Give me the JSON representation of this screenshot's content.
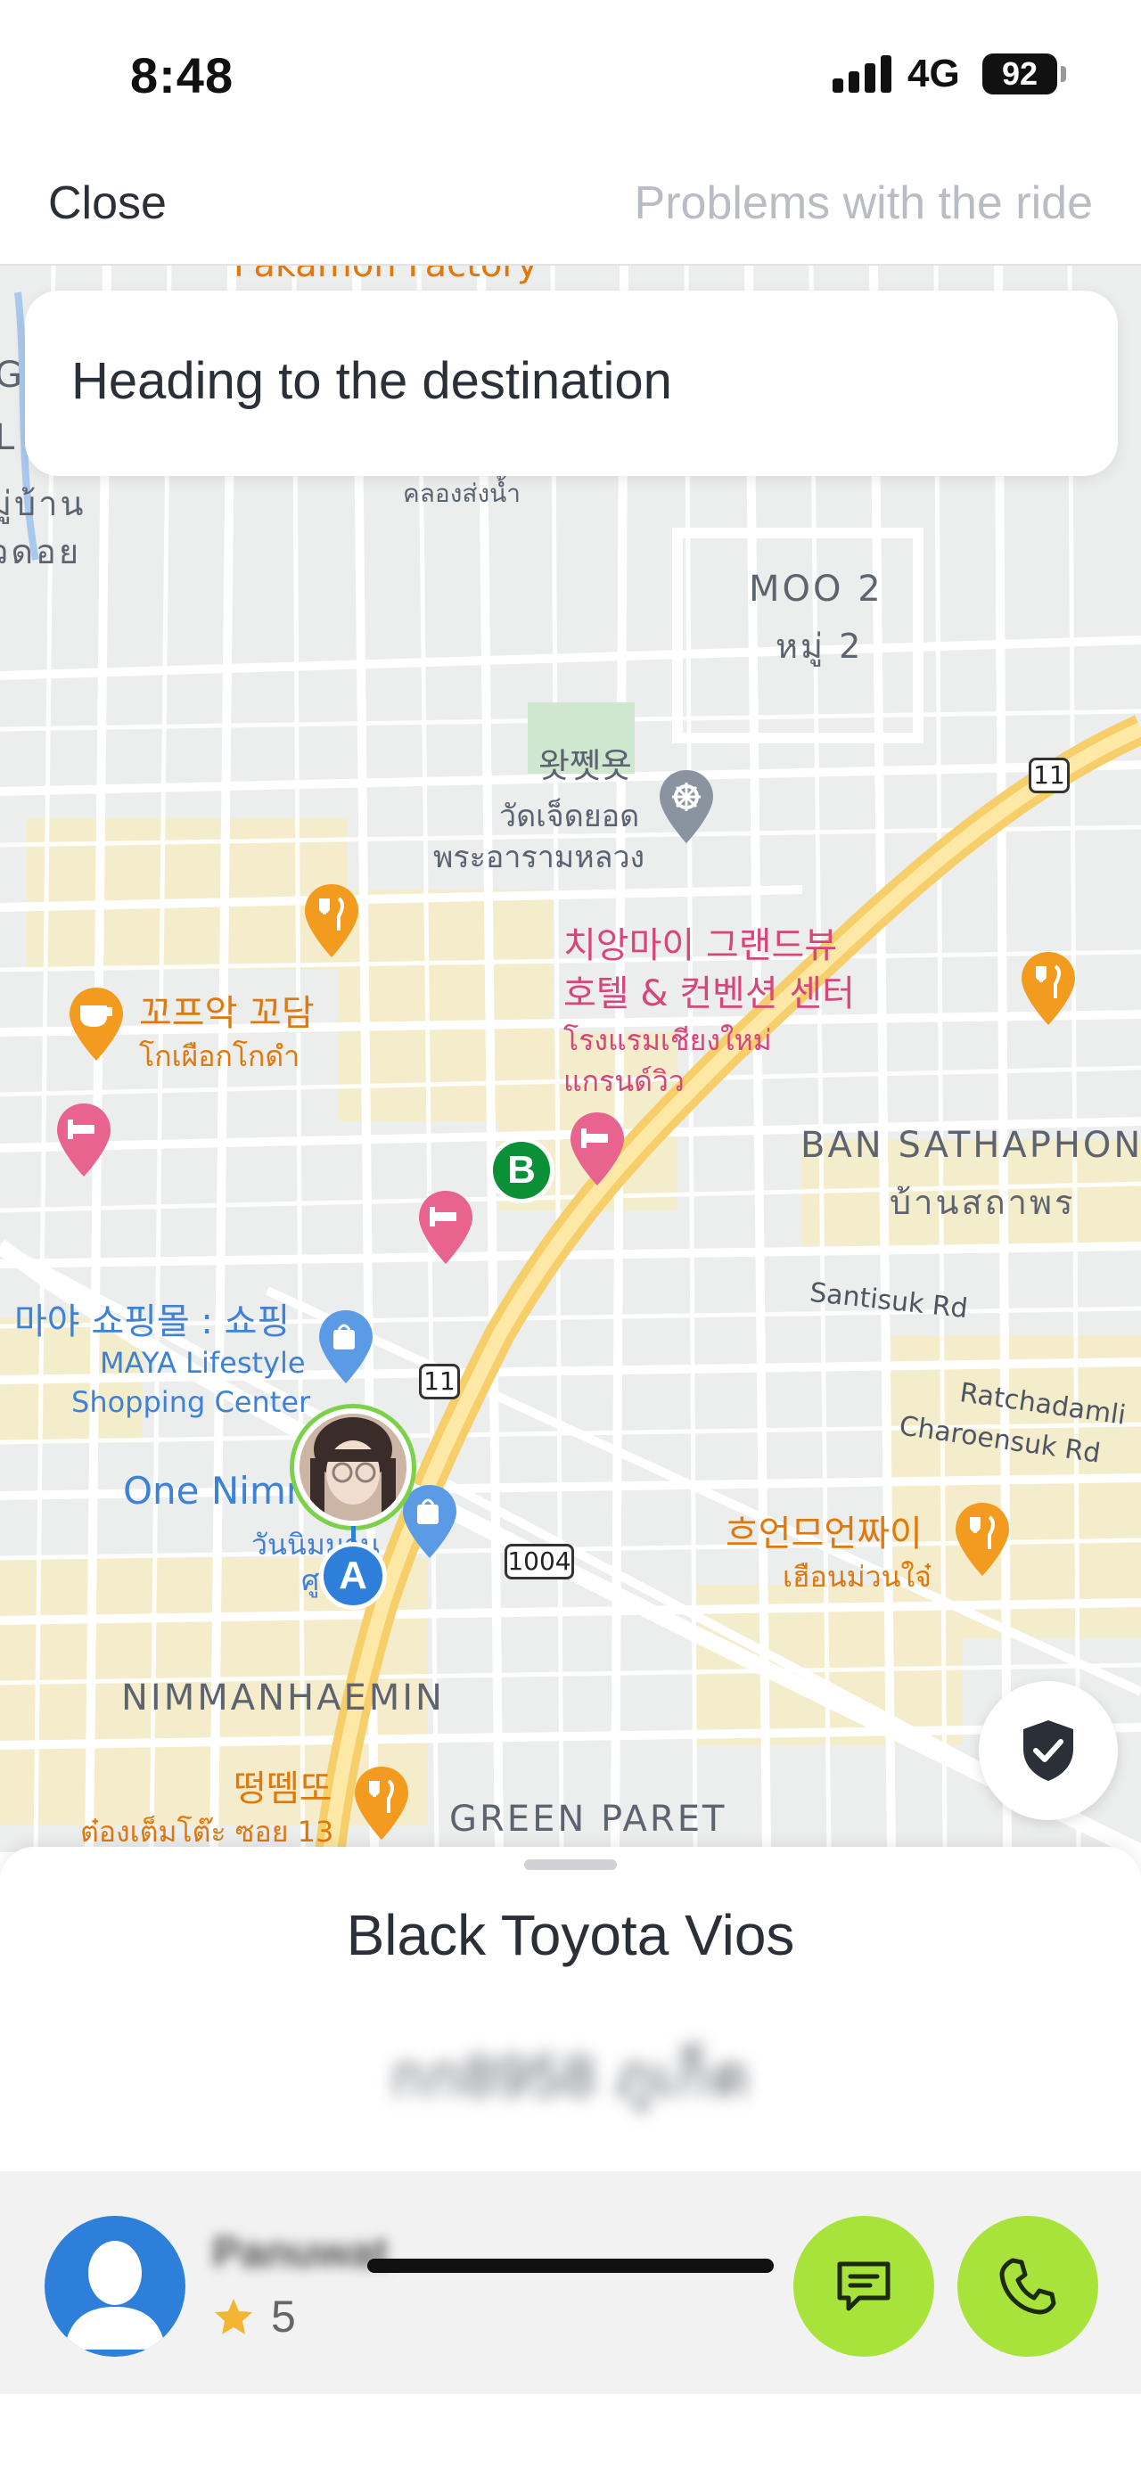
{
  "status_bar": {
    "time": "8:48",
    "network": "4G",
    "battery": "92"
  },
  "nav": {
    "close_label": "Close",
    "problems_label": "Problems with the ride"
  },
  "trip_status": {
    "text": "Heading to the destination"
  },
  "map": {
    "labels": {
      "pakamon": "Pakamon Factory",
      "klong": "คลองส่งน้ำ",
      "moo2": "MOO 2",
      "moo2_th": "หมู่ 2",
      "wat_ko": "왓쩻욧",
      "wat_th1": "วัดเจ็ดยอด",
      "wat_th2": "พระอารามหลวง",
      "hotel_ko1": "치앙마이 그랜드뷰",
      "hotel_ko2": "호텔 & 컨벤션 센터",
      "hotel_th1": "โรงแรมเชียงใหม่",
      "hotel_th2": "แกรนด์วิว",
      "cafe_ko": "꼬프악 꼬담",
      "cafe_th": "โกเผือกโกดำ",
      "ban_sathaphon": "BAN SATHAPHON",
      "ban_sathaphon_th": "บ้านสถาพร",
      "santisuk": "Santisuk Rd",
      "ratchadamli": "Ratchadamli",
      "charoensuk": "Charoensuk Rd",
      "maya_ko": "마야 쇼핑몰 : 쇼핑",
      "maya_en1": "MAYA Lifestyle",
      "maya_en2": "Shopping Center",
      "one_nimman": "One Nimman",
      "one_nimman_th": "วันนิมมาน",
      "one_nimman_th2": "ศูนย์",
      "road_11a": "11",
      "road_11b": "11",
      "road_1004": "1004",
      "restaurant_ko": "흐언므언짜이",
      "restaurant_th": "เฮือนม่วนใจ๋",
      "nimmanhaemin": "NIMMANHAEMIN",
      "green_paret": "GREEN PARET",
      "ddeok_ko": "떵뗌또",
      "ddeok_th": "ต๋องเต็มโต๊ะ ซอย 13",
      "side_left1": "G",
      "side_left2": "L",
      "side_left3": "มู่บ้าน",
      "side_left4": "วดอย"
    },
    "markers": {
      "point_a": "A",
      "point_b": "B"
    }
  },
  "vehicle": {
    "description": "Black Toyota Vios",
    "plate": "กก8958 ภูเก็ต"
  },
  "driver": {
    "name": "Panuwat",
    "rating": "5"
  },
  "colors": {
    "accent_green": "#a7e33a",
    "route_green": "#0b8f37",
    "marker_blue": "#2d7fd9",
    "avatar_blue": "#2d7fd9"
  },
  "icons": {
    "shield": "shield-check-icon",
    "chat": "chat-icon",
    "phone": "phone-icon",
    "star": "star-icon",
    "person": "person-icon"
  }
}
